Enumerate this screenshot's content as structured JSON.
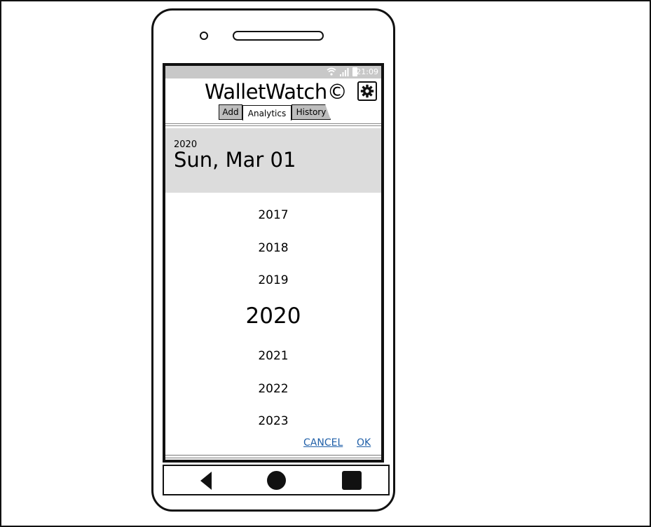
{
  "status": {
    "time": "21:09"
  },
  "app": {
    "title": "WalletWatch©"
  },
  "tabs": [
    {
      "label": "Add"
    },
    {
      "label": "Analytics"
    },
    {
      "label": "History"
    }
  ],
  "picker": {
    "header_year": "2020",
    "header_date": "Sun, Mar 01",
    "years": [
      "2017",
      "2018",
      "2019",
      "2020",
      "2021",
      "2022",
      "2023"
    ],
    "selected_year": "2020",
    "cancel_label": "CANCEL",
    "ok_label": "OK"
  },
  "colors": {
    "link": "#1f5fa8",
    "header_bg": "#dcdcdc",
    "statusbar_bg": "#c8c8c8"
  }
}
